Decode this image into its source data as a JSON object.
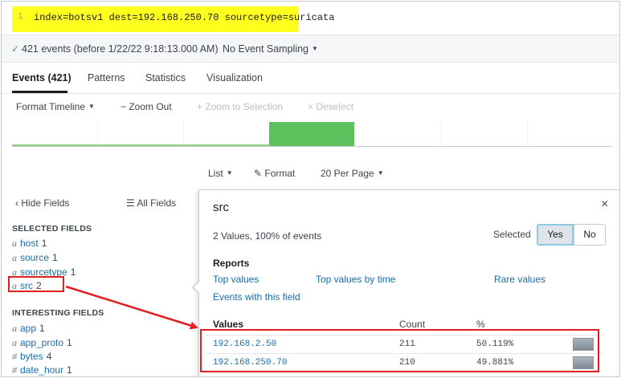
{
  "search": {
    "line_number": "1",
    "query": "index=botsv1 dest=192.168.250.70 sourcetype=suricata",
    "highlight_color": "#ffff1f"
  },
  "status": {
    "check_icon": "check-icon",
    "events_text": "421 events (before 1/22/22 9:18:13.000 AM)",
    "sampling_label": "No Event Sampling"
  },
  "tabs": [
    {
      "label": "Events (421)",
      "active": true
    },
    {
      "label": "Patterns",
      "active": false
    },
    {
      "label": "Statistics",
      "active": false
    },
    {
      "label": "Visualization",
      "active": false
    }
  ],
  "timeline_toolbar": {
    "format_timeline": "Format Timeline",
    "zoom_out": "− Zoom Out",
    "zoom_to_selection": "+ Zoom to Selection",
    "deselect": "× Deselect"
  },
  "timeline": {
    "highlight_bar_color": "#5cc05c"
  },
  "results_toolbar": {
    "list": "List",
    "format": "Format",
    "per_page": "20 Per Page"
  },
  "sidebar": {
    "hide_fields": "Hide Fields",
    "all_fields": "All Fields",
    "selected_heading": "SELECTED FIELDS",
    "selected_fields": [
      {
        "type": "a",
        "name": "host",
        "count": "1"
      },
      {
        "type": "a",
        "name": "source",
        "count": "1"
      },
      {
        "type": "a",
        "name": "sourcetype",
        "count": "1"
      },
      {
        "type": "a",
        "name": "src",
        "count": "2"
      }
    ],
    "interesting_heading": "INTERESTING FIELDS",
    "interesting_fields": [
      {
        "type": "a",
        "name": "app",
        "count": "1"
      },
      {
        "type": "a",
        "name": "app_proto",
        "count": "1"
      },
      {
        "type": "#",
        "name": "bytes",
        "count": "4"
      },
      {
        "type": "#",
        "name": "date_hour",
        "count": "1"
      }
    ]
  },
  "panel": {
    "title": "src",
    "close": "×",
    "summary": "2 Values, 100% of events",
    "selected_label": "Selected",
    "yes": "Yes",
    "no": "No",
    "reports_heading": "Reports",
    "report_links": [
      "Top values",
      "Top values by time",
      "Rare values",
      "Events with this field"
    ],
    "table_headers": {
      "values": "Values",
      "count": "Count",
      "percent": "%"
    },
    "rows": [
      {
        "value": "192.168.2.50",
        "count": "211",
        "percent": "50.119%"
      },
      {
        "value": "192.168.250.70",
        "count": "210",
        "percent": "49.881%"
      }
    ]
  },
  "annotation_color": "#e02020"
}
